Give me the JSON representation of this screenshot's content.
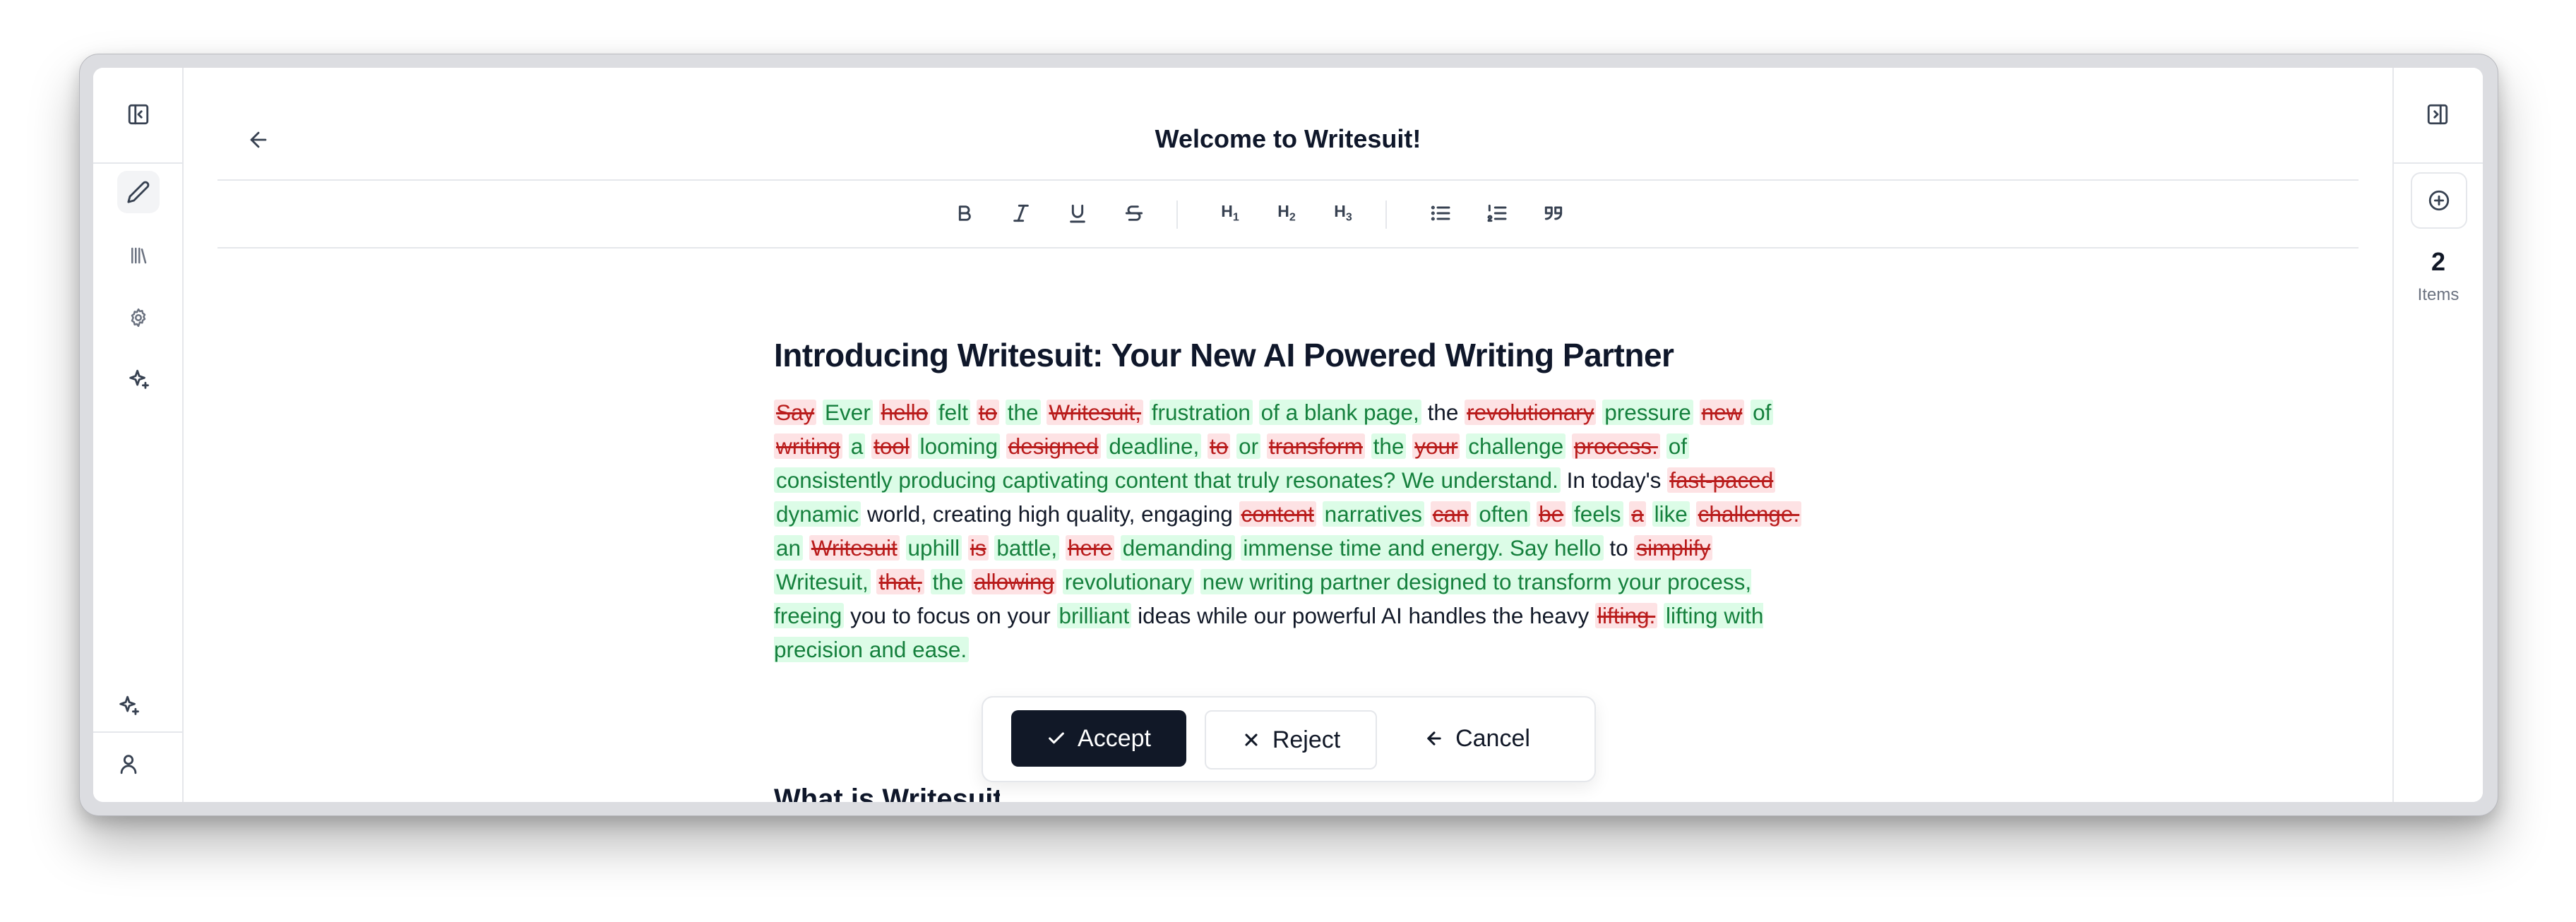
{
  "header": {
    "title": "Welcome to Writesuit!"
  },
  "toolbar": {
    "h1": "H",
    "h2": "H",
    "h3": "H"
  },
  "document": {
    "heading": "Introducing Writesuit: Your New AI Powered Writing Partner",
    "segments": [
      {
        "t": "Say",
        "k": "del"
      },
      {
        "t": " ",
        "k": "txt"
      },
      {
        "t": "Ever",
        "k": "ins"
      },
      {
        "t": " ",
        "k": "txt"
      },
      {
        "t": "hello",
        "k": "del"
      },
      {
        "t": " ",
        "k": "txt"
      },
      {
        "t": "felt",
        "k": "ins"
      },
      {
        "t": " ",
        "k": "txt"
      },
      {
        "t": "to",
        "k": "del"
      },
      {
        "t": " ",
        "k": "txt"
      },
      {
        "t": "the",
        "k": "ins"
      },
      {
        "t": " ",
        "k": "txt"
      },
      {
        "t": "Writesuit,",
        "k": "del"
      },
      {
        "t": " ",
        "k": "txt"
      },
      {
        "t": "frustration",
        "k": "ins"
      },
      {
        "t": " ",
        "k": "txt"
      },
      {
        "t": "of a blank page,",
        "k": "ins"
      },
      {
        "t": " the ",
        "k": "txt"
      },
      {
        "t": "revolutionary",
        "k": "del"
      },
      {
        "t": " ",
        "k": "txt"
      },
      {
        "t": "pressure",
        "k": "ins"
      },
      {
        "t": " ",
        "k": "txt"
      },
      {
        "t": "new",
        "k": "del"
      },
      {
        "t": " ",
        "k": "txt"
      },
      {
        "t": "of",
        "k": "ins"
      },
      {
        "t": " ",
        "k": "txt"
      },
      {
        "t": "writing",
        "k": "del"
      },
      {
        "t": " ",
        "k": "txt"
      },
      {
        "t": "a",
        "k": "ins"
      },
      {
        "t": " ",
        "k": "txt"
      },
      {
        "t": "tool",
        "k": "del"
      },
      {
        "t": " ",
        "k": "txt"
      },
      {
        "t": "looming",
        "k": "ins"
      },
      {
        "t": " ",
        "k": "txt"
      },
      {
        "t": "designed",
        "k": "del"
      },
      {
        "t": " ",
        "k": "txt"
      },
      {
        "t": "deadline,",
        "k": "ins"
      },
      {
        "t": " ",
        "k": "txt"
      },
      {
        "t": "to",
        "k": "del"
      },
      {
        "t": " ",
        "k": "txt"
      },
      {
        "t": "or",
        "k": "ins"
      },
      {
        "t": " ",
        "k": "txt"
      },
      {
        "t": "transform",
        "k": "del"
      },
      {
        "t": " ",
        "k": "txt"
      },
      {
        "t": "the",
        "k": "ins"
      },
      {
        "t": " ",
        "k": "txt"
      },
      {
        "t": "your",
        "k": "del"
      },
      {
        "t": " ",
        "k": "txt"
      },
      {
        "t": "challenge",
        "k": "ins"
      },
      {
        "t": " ",
        "k": "txt"
      },
      {
        "t": "process.",
        "k": "del"
      },
      {
        "t": " ",
        "k": "txt"
      },
      {
        "t": "of",
        "k": "ins"
      },
      {
        "t": " ",
        "k": "txt"
      },
      {
        "t": "consistently producing captivating content that truly resonates? We understand.",
        "k": "ins"
      },
      {
        "t": " In today's ",
        "k": "txt"
      },
      {
        "t": "fast-paced",
        "k": "del"
      },
      {
        "t": " ",
        "k": "txt"
      },
      {
        "t": "dynamic",
        "k": "ins"
      },
      {
        "t": " world, creating high quality, engaging ",
        "k": "txt"
      },
      {
        "t": "content",
        "k": "del"
      },
      {
        "t": " ",
        "k": "txt"
      },
      {
        "t": "narratives",
        "k": "ins"
      },
      {
        "t": " ",
        "k": "txt"
      },
      {
        "t": "can",
        "k": "del"
      },
      {
        "t": " ",
        "k": "txt"
      },
      {
        "t": "often",
        "k": "ins"
      },
      {
        "t": " ",
        "k": "txt"
      },
      {
        "t": "be",
        "k": "del"
      },
      {
        "t": " ",
        "k": "txt"
      },
      {
        "t": "feels",
        "k": "ins"
      },
      {
        "t": " ",
        "k": "txt"
      },
      {
        "t": "a",
        "k": "del"
      },
      {
        "t": " ",
        "k": "txt"
      },
      {
        "t": "like",
        "k": "ins"
      },
      {
        "t": " ",
        "k": "txt"
      },
      {
        "t": "challenge.",
        "k": "del"
      },
      {
        "t": " ",
        "k": "txt"
      },
      {
        "t": "an",
        "k": "ins"
      },
      {
        "t": " ",
        "k": "txt"
      },
      {
        "t": "Writesuit",
        "k": "del"
      },
      {
        "t": " ",
        "k": "txt"
      },
      {
        "t": "uphill",
        "k": "ins"
      },
      {
        "t": " ",
        "k": "txt"
      },
      {
        "t": "is",
        "k": "del"
      },
      {
        "t": " ",
        "k": "txt"
      },
      {
        "t": "battle,",
        "k": "ins"
      },
      {
        "t": " ",
        "k": "txt"
      },
      {
        "t": "here",
        "k": "del"
      },
      {
        "t": " ",
        "k": "txt"
      },
      {
        "t": "demanding",
        "k": "ins"
      },
      {
        "t": " ",
        "k": "txt"
      },
      {
        "t": "immense time and energy. Say hello",
        "k": "ins"
      },
      {
        "t": " to ",
        "k": "txt"
      },
      {
        "t": "simplify",
        "k": "del"
      },
      {
        "t": " ",
        "k": "txt"
      },
      {
        "t": "Writesuit,",
        "k": "ins"
      },
      {
        "t": " ",
        "k": "txt"
      },
      {
        "t": "that,",
        "k": "del"
      },
      {
        "t": " ",
        "k": "txt"
      },
      {
        "t": "the",
        "k": "ins"
      },
      {
        "t": " ",
        "k": "txt"
      },
      {
        "t": "allowing",
        "k": "del"
      },
      {
        "t": " ",
        "k": "txt"
      },
      {
        "t": "revolutionary",
        "k": "ins"
      },
      {
        "t": " ",
        "k": "txt"
      },
      {
        "t": "new writing partner designed to transform your process, freeing",
        "k": "ins"
      },
      {
        "t": " you to focus on your ",
        "k": "txt"
      },
      {
        "t": "brilliant",
        "k": "ins"
      },
      {
        "t": " ideas while our powerful AI handles the heavy ",
        "k": "txt"
      },
      {
        "t": "lifting.",
        "k": "del"
      },
      {
        "t": " ",
        "k": "txt"
      },
      {
        "t": "lifting with precision and ease.",
        "k": "ins"
      }
    ],
    "subheading": "What is Writesuit?"
  },
  "review": {
    "accept": "Accept",
    "reject": "Reject",
    "cancel": "Cancel"
  },
  "right_sidebar": {
    "count": "2",
    "count_label": "Items"
  },
  "colors": {
    "insert_bg": "#dcfce7",
    "insert_fg": "#15803d",
    "delete_bg": "#fde2e4",
    "delete_fg": "#b91c1c",
    "primary": "#111827"
  }
}
